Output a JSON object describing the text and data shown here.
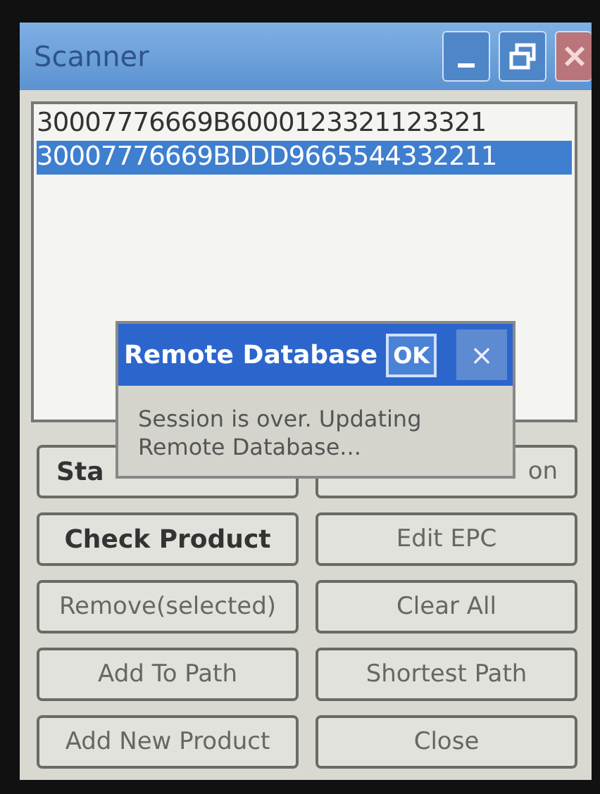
{
  "window": {
    "title": "Scanner"
  },
  "list": {
    "items": [
      {
        "text": "30007776669B6000123321123321",
        "selected": false
      },
      {
        "text": "30007776669BDDD9665544332211",
        "selected": true
      }
    ]
  },
  "buttons": [
    {
      "label": "Sta",
      "bold": true,
      "kind": "start"
    },
    {
      "label": "on",
      "bold": false,
      "kind": "end"
    },
    {
      "label": "Check Product",
      "bold": true,
      "kind": "whole"
    },
    {
      "label": "Edit EPC",
      "bold": false,
      "kind": "whole"
    },
    {
      "label": "Remove(selected)",
      "bold": false,
      "kind": "whole"
    },
    {
      "label": "Clear All",
      "bold": false,
      "kind": "whole"
    },
    {
      "label": "Add To Path",
      "bold": false,
      "kind": "whole"
    },
    {
      "label": "Shortest Path",
      "bold": false,
      "kind": "whole"
    },
    {
      "label": "Add New Product",
      "bold": false,
      "kind": "whole"
    },
    {
      "label": "Close",
      "bold": false,
      "kind": "whole"
    }
  ],
  "dialog": {
    "title": "Remote Database",
    "ok": "OK",
    "close": "×",
    "message": "Session is over. Updating Remote Database..."
  }
}
